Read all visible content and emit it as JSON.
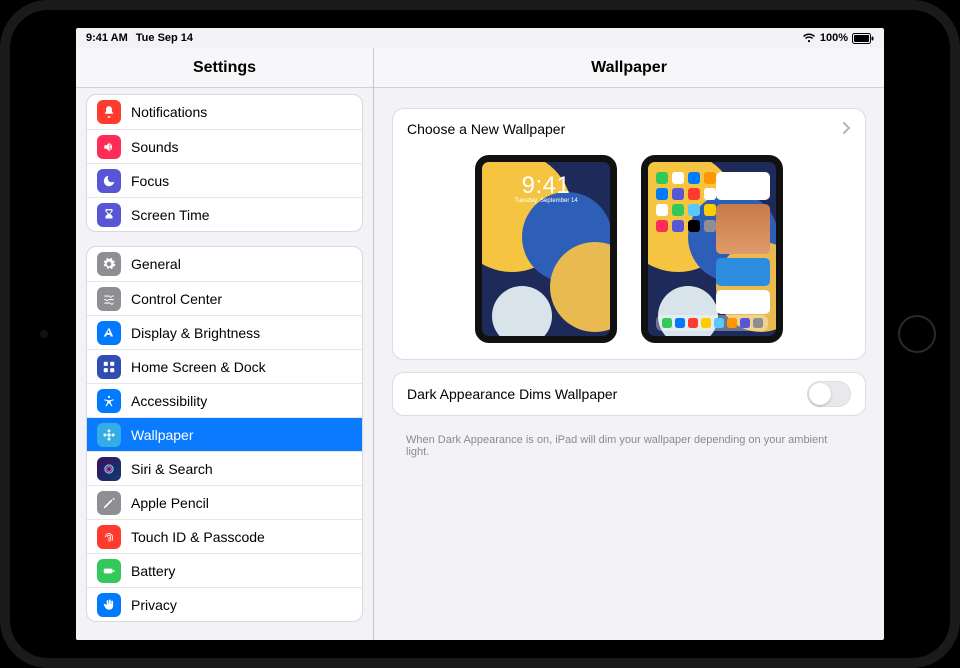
{
  "status": {
    "time": "9:41 AM",
    "date": "Tue Sep 14",
    "battery_pct": "100%"
  },
  "sidebar": {
    "title": "Settings",
    "group1": [
      {
        "label": "Notifications"
      },
      {
        "label": "Sounds"
      },
      {
        "label": "Focus"
      },
      {
        "label": "Screen Time"
      }
    ],
    "group2": [
      {
        "label": "General"
      },
      {
        "label": "Control Center"
      },
      {
        "label": "Display & Brightness"
      },
      {
        "label": "Home Screen & Dock"
      },
      {
        "label": "Accessibility"
      },
      {
        "label": "Wallpaper"
      },
      {
        "label": "Siri & Search"
      },
      {
        "label": "Apple Pencil"
      },
      {
        "label": "Touch ID & Passcode"
      },
      {
        "label": "Battery"
      },
      {
        "label": "Privacy"
      }
    ]
  },
  "detail": {
    "title": "Wallpaper",
    "choose_row": "Choose a New Wallpaper",
    "lock_preview": {
      "time": "9:41",
      "date": "Tuesday, September 14"
    },
    "dark_toggle_label": "Dark Appearance Dims Wallpaper",
    "dark_toggle_on": false,
    "footer": "When Dark Appearance is on, iPad will dim your wallpaper depending on your ambient light."
  }
}
